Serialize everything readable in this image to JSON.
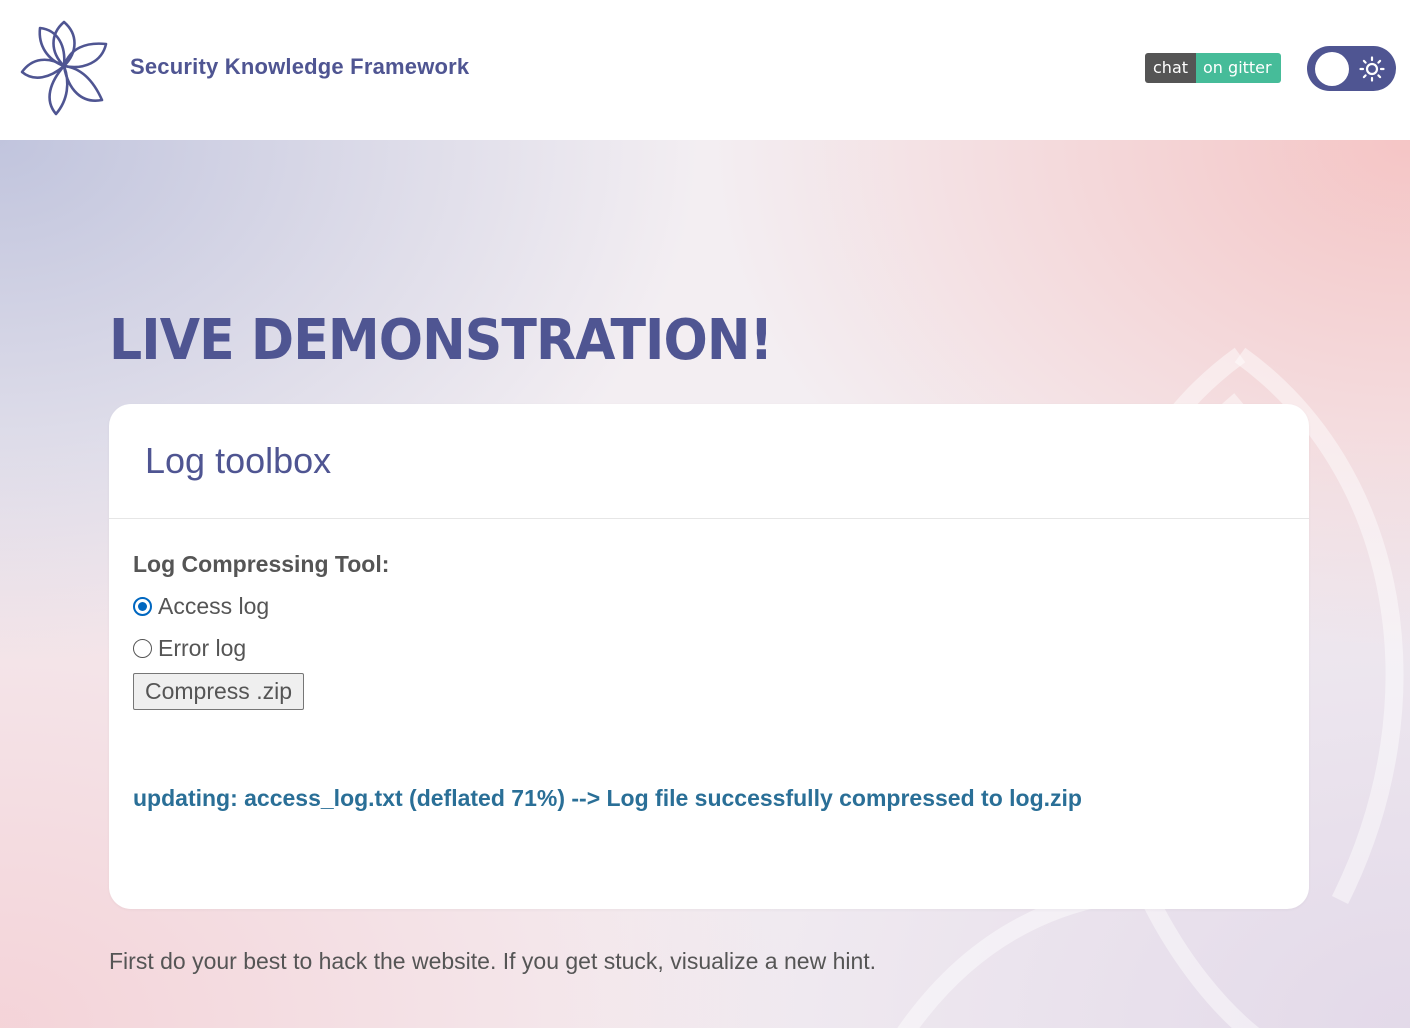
{
  "header": {
    "brand": "Security Knowledge Framework",
    "logo_icon": "flower-logo-icon",
    "gitter_badge": {
      "left": "chat",
      "right": "on gitter"
    },
    "theme_toggle": {
      "icon": "sun-icon",
      "state": "light"
    }
  },
  "hero": {
    "title": "LIVE DEMONSTRATION!"
  },
  "card": {
    "title": "Log toolbox",
    "tool_label": "Log Compressing Tool:",
    "options": [
      {
        "label": "Access log",
        "checked": true
      },
      {
        "label": "Error log",
        "checked": false
      }
    ],
    "button_label": "Compress .zip",
    "result": "updating: access_log.txt (deflated 71%) --> Log file successfully compressed to log.zip"
  },
  "hint": "First do your best to hack the website. If you get stuck, visualize a new hint.",
  "colors": {
    "brand": "#4f5592",
    "result": "#2a6f97",
    "text": "#555555",
    "gitter_left": "#555555",
    "gitter_right": "#46bc99"
  }
}
